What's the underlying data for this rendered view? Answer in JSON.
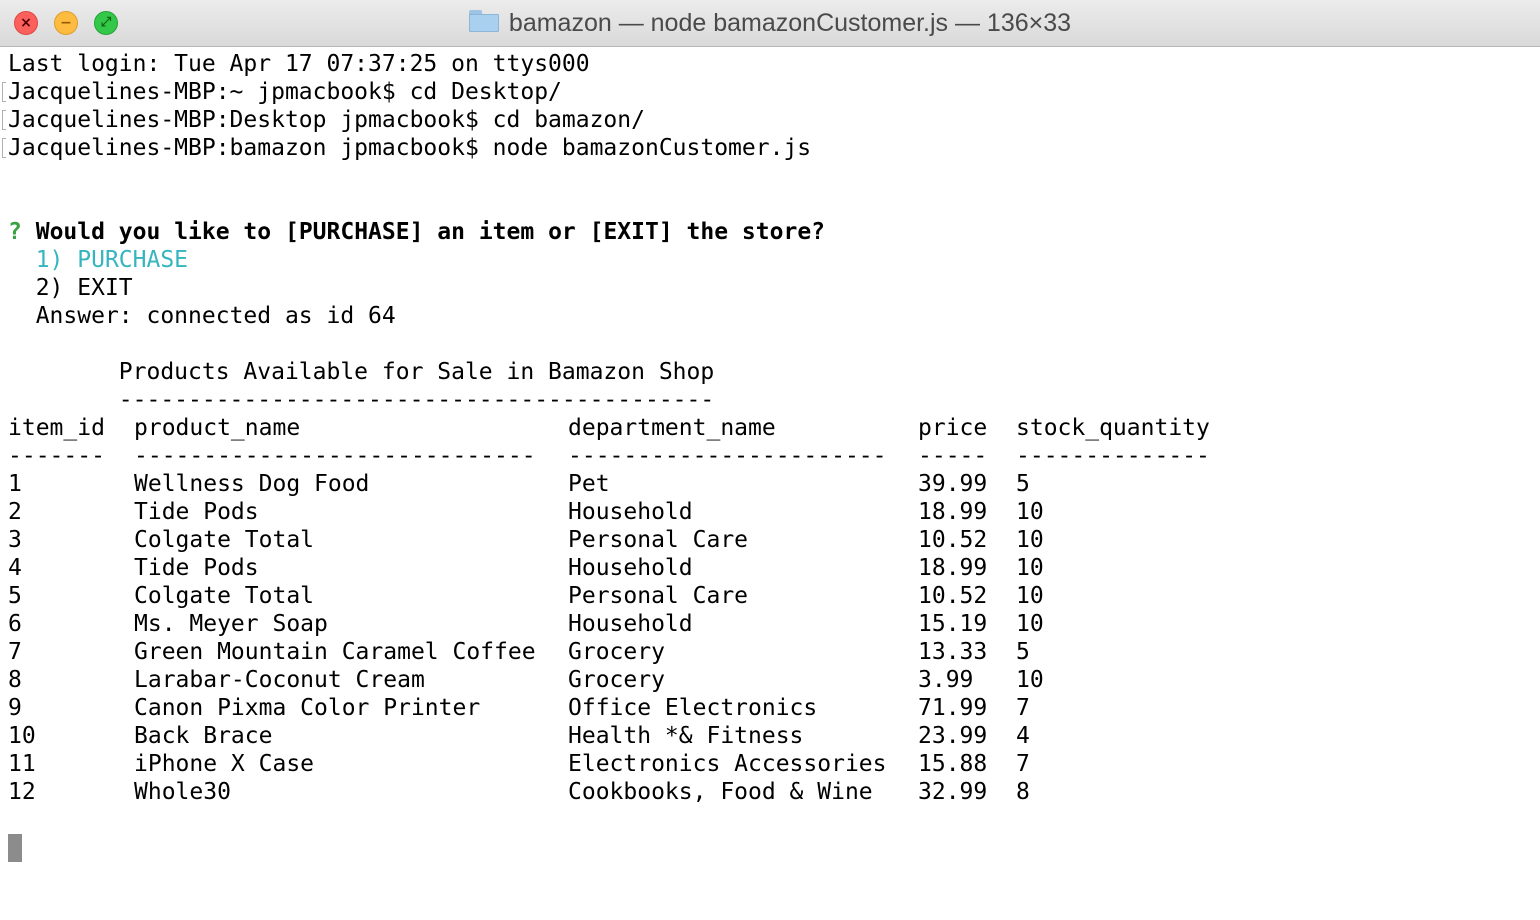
{
  "window": {
    "title": "bamazon — node bamazonCustomer.js — 136×33",
    "folder_icon": "folder-icon"
  },
  "terminal": {
    "session_lines": [
      "Last login: Tue Apr 17 07:37:25 on ttys000",
      "Jacquelines-MBP:~ jpmacbook$ cd Desktop/",
      "Jacquelines-MBP:Desktop jpmacbook$ cd bamazon/",
      "Jacquelines-MBP:bamazon jpmacbook$ node bamazonCustomer.js"
    ],
    "prompt": {
      "marker": "?",
      "question": "Would you like to [PURCHASE] an item or [EXIT] the store?",
      "options": [
        "1) PURCHASE",
        "2) EXIT"
      ],
      "answer": "Answer: connected as id 64"
    },
    "table": {
      "heading": "Products Available for Sale in Bamazon Shop",
      "heading_rule": "-------------------------------------------",
      "columns": [
        "item_id",
        "product_name",
        "department_name",
        "price",
        "stock_quantity"
      ],
      "rules": [
        "-------",
        "-----------------------------",
        "-----------------------",
        "-----",
        "--------------"
      ],
      "rows": [
        [
          "1",
          "Wellness Dog Food",
          "Pet",
          "39.99",
          "5"
        ],
        [
          "2",
          "Tide Pods",
          "Household",
          "18.99",
          "10"
        ],
        [
          "3",
          "Colgate Total",
          "Personal Care",
          "10.52",
          "10"
        ],
        [
          "4",
          "Tide Pods",
          "Household",
          "18.99",
          "10"
        ],
        [
          "5",
          "Colgate Total",
          "Personal Care",
          "10.52",
          "10"
        ],
        [
          "6",
          "Ms. Meyer Soap",
          "Household",
          "15.19",
          "10"
        ],
        [
          "7",
          "Green Mountain Caramel Coffee",
          "Grocery",
          "13.33",
          "5"
        ],
        [
          "8",
          "Larabar-Coconut Cream",
          "Grocery",
          "3.99",
          "10"
        ],
        [
          "9",
          "Canon Pixma Color Printer",
          "Office Electronics",
          "71.99",
          "7"
        ],
        [
          "10",
          "Back Brace",
          "Health *& Fitness",
          "23.99",
          "4"
        ],
        [
          "11",
          "iPhone X Case",
          "Electronics Accessories",
          "15.88",
          "7"
        ],
        [
          "12",
          "Whole30",
          "Cookbooks, Food & Wine",
          "32.99",
          "8"
        ]
      ]
    },
    "colors": {
      "prompt_marker": "#3aa142",
      "selected_option": "#36b5bf",
      "cursor": "#8c8c8c"
    }
  }
}
